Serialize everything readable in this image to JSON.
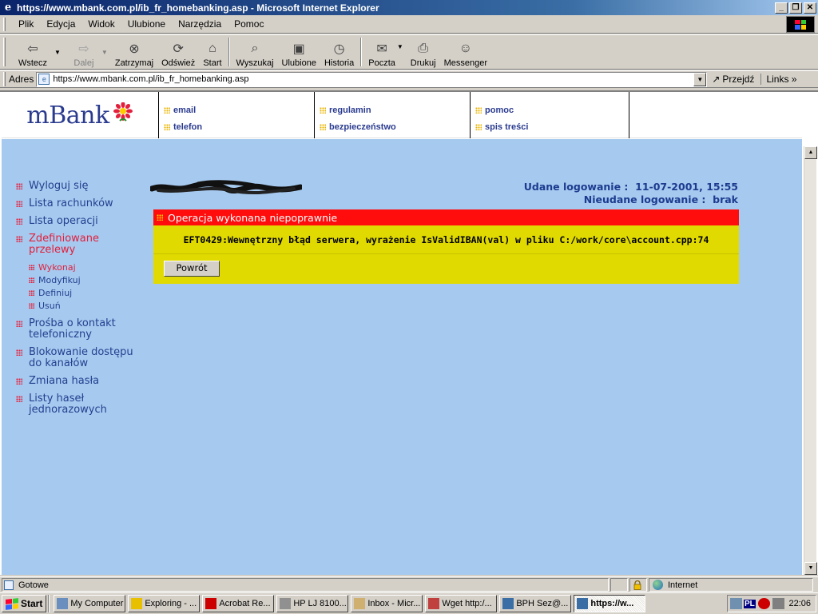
{
  "window": {
    "title": "https://www.mbank.com.pl/ib_fr_homebanking.asp - Microsoft Internet Explorer",
    "controls": {
      "minimize": "_",
      "maximize": "❐",
      "close": "✕"
    }
  },
  "menu": [
    "Plik",
    "Edycja",
    "Widok",
    "Ulubione",
    "Narzędzia",
    "Pomoc"
  ],
  "toolbar": {
    "back": "Wstecz",
    "forward": "Dalej",
    "stop": "Zatrzymaj",
    "refresh": "Odśwież",
    "home": "Start",
    "search": "Wyszukaj",
    "favorites": "Ulubione",
    "history": "Historia",
    "mail": "Poczta",
    "print": "Drukuj",
    "messenger": "Messenger"
  },
  "address": {
    "label": "Adres",
    "url": "https://www.mbank.com.pl/ib_fr_homebanking.asp",
    "go": "Przejdź",
    "links": "Links"
  },
  "page": {
    "logo": "mBank",
    "header_links": [
      [
        "email",
        "telefon"
      ],
      [
        "regulamin",
        "bezpieczeństwo"
      ],
      [
        "pomoc",
        "spis treści"
      ]
    ],
    "sidenav": {
      "logout": "Wyloguj się",
      "accounts": "Lista rachunków",
      "operations": "Lista operacji",
      "defined_transfers": "Zdefiniowane przelewy",
      "sub": {
        "execute": "Wykonaj",
        "modify": "Modyfikuj",
        "define": "Definiuj",
        "delete": "Usuń"
      },
      "phone_contact": "Prośba o kontakt telefoniczny",
      "block_access": "Blokowanie dostępu do kanałów",
      "change_password": "Zmiana hasła",
      "otp_lists": "Listy haseł jednorazowych"
    },
    "login": {
      "success_label": "Udane logowanie :",
      "success_value": "11-07-2001, 15:55",
      "failed_label": "Nieudane logowanie :",
      "failed_value": "brak"
    },
    "error": {
      "title": "Operacja wykonana niepoprawnie",
      "message": "EFT0429:Wewnętrzny błąd serwera, wyrażenie IsValidIBAN(val) w pliku C:/work/core\\account.cpp:74",
      "back_button": "Powrót"
    }
  },
  "status": {
    "text": "Gotowe",
    "zone": "Internet"
  },
  "taskbar": {
    "start": "Start",
    "tasks": [
      "My Computer",
      "Exploring - ...",
      "Acrobat Re...",
      "HP LJ 8100...",
      "Inbox - Micr...",
      "Wget http:/...",
      "BPH Sez@...",
      "https://w..."
    ],
    "lang": "PL",
    "clock": "22:06"
  },
  "colors": {
    "page_bg": "#a6c9ef",
    "error_header": "#ff0d0d",
    "error_body": "#e0da00",
    "nav_text": "#23408f",
    "nav_active": "#e2203c",
    "logo": "#2a3b8f"
  }
}
